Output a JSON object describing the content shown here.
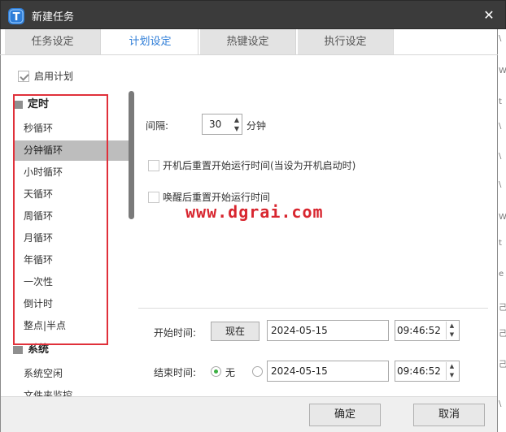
{
  "window": {
    "title": "新建任务",
    "close_glyph": "✕",
    "logo_letter": "T",
    "logo_color": "#2f7ed8"
  },
  "tabs": [
    {
      "label": "任务设定",
      "active": false
    },
    {
      "label": "计划设定",
      "active": true
    },
    {
      "label": "热键设定",
      "active": false
    },
    {
      "label": "执行设定",
      "active": false
    }
  ],
  "enable_schedule": {
    "label": "启用计划",
    "checked": true
  },
  "schedule_list": {
    "groups": [
      {
        "name": "定时",
        "items": [
          "秒循环",
          "分钟循环",
          "小时循环",
          "天循环",
          "周循环",
          "月循环",
          "年循环",
          "一次性",
          "倒计时",
          "整点|半点"
        ]
      },
      {
        "name": "系统",
        "items": [
          "系统空闲",
          "文件夹监控"
        ]
      }
    ],
    "selected": "分钟循环"
  },
  "interval": {
    "label": "间隔:",
    "value": "30",
    "unit": "分钟"
  },
  "options": [
    {
      "label": "开机后重置开始运行时间(当设为开机启动时)",
      "checked": false
    },
    {
      "label": "唤醒后重置开始运行时间",
      "checked": false
    }
  ],
  "watermark": "www.dgrai.com",
  "start_time": {
    "label": "开始时间:",
    "now_button": "现在",
    "date": "2024-05-15",
    "time": "09:46:52"
  },
  "end_time": {
    "label": "结束时间:",
    "none_label": "无",
    "none_selected": true,
    "date": "2024-05-15",
    "time": "09:46:52"
  },
  "footer": {
    "ok": "确定",
    "cancel": "取消"
  },
  "background_window_chars": [
    "\\",
    "W",
    "t",
    "\\",
    "\\",
    "\\",
    "W",
    "t",
    "e",
    "己",
    "己",
    "己",
    "\\"
  ],
  "colors": {
    "accent": "#2f7ed8",
    "titlebar": "#3b3b3b",
    "highlight_frame": "#e0303a",
    "radio_on": "#3cb043",
    "watermark": "#d8262f"
  }
}
